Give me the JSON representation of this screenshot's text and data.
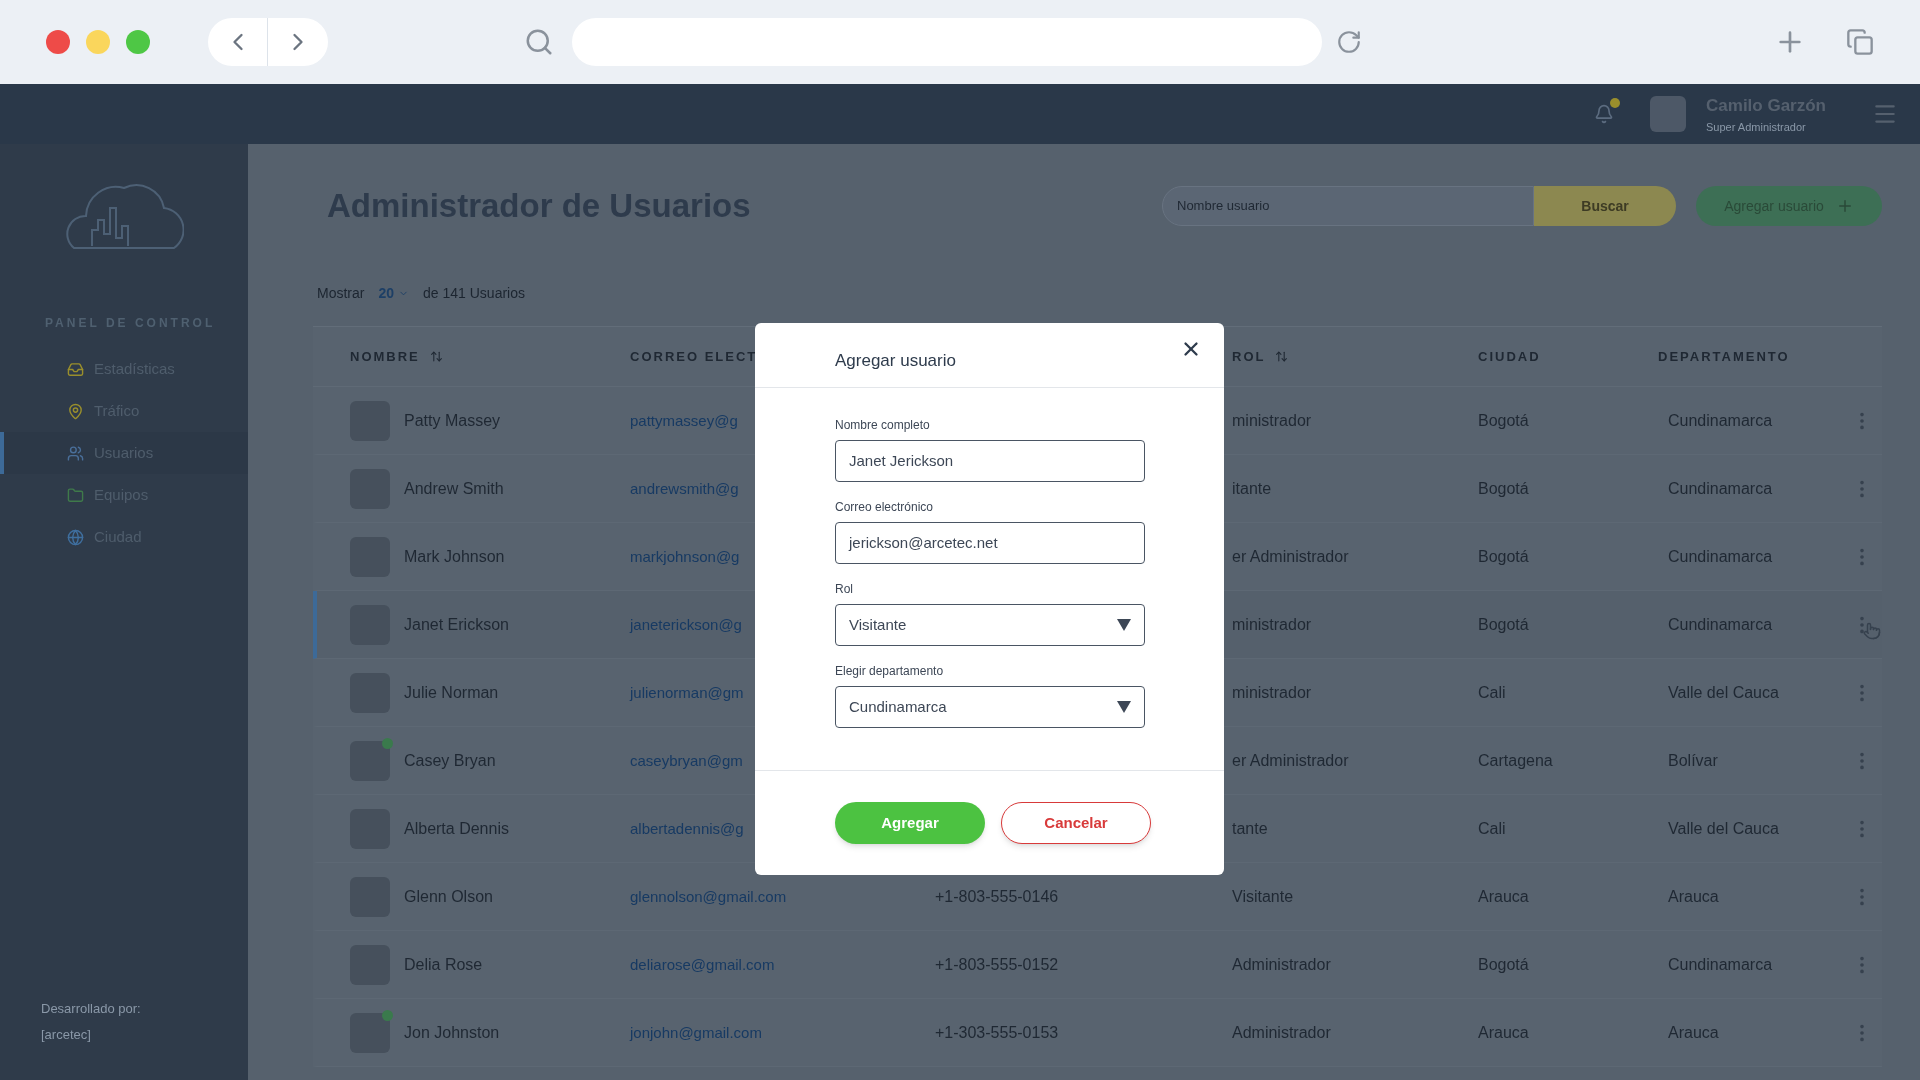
{
  "topbar": {
    "notifications": true,
    "user_name": "Camilo Garzón",
    "user_role": "Super Administrador"
  },
  "sidebar": {
    "section": "PANEL DE CONTROL",
    "items": [
      {
        "label": "Estadísticas",
        "kind": "stats",
        "selected": false
      },
      {
        "label": "Tráfico",
        "kind": "pin",
        "selected": false
      },
      {
        "label": "Usuarios",
        "kind": "users",
        "selected": true
      },
      {
        "label": "Equipos",
        "kind": "folder",
        "selected": false
      },
      {
        "label": "Ciudad",
        "kind": "city",
        "selected": false
      }
    ],
    "footer": [
      "Desarrollado por:",
      "[arcetec]"
    ]
  },
  "page": {
    "title": "Administrador de Usuarios",
    "search": {
      "placeholder": "Nombre usuario"
    },
    "search_button": "Buscar",
    "add_button": "Agregar usuario"
  },
  "listing": {
    "show_label": "Mostrar",
    "page_size": "20",
    "total": "de 141 Usuarios"
  },
  "table": {
    "columns": [
      {
        "label": "NOMBRE",
        "sortable": true
      },
      {
        "label": "CORREO ELECT"
      },
      {
        "label": "ROL",
        "sortable": true
      },
      {
        "label": "CIUDAD",
        "sortable": false
      },
      {
        "label": "DEPARTAMENTO",
        "sortable": false
      }
    ],
    "rows": [
      {
        "name": "Patty Massey",
        "email": "pattymassey@g",
        "role": "ministrador",
        "city": "Bogotá",
        "department": "Cundinamarca",
        "online": false,
        "selected": false
      },
      {
        "name": "Andrew Smith",
        "email": "andrewsmith@g",
        "role": "itante",
        "city": "Bogotá",
        "department": "Cundinamarca",
        "online": false,
        "selected": false
      },
      {
        "name": "Mark Johnson",
        "email": "markjohnson@g",
        "role": "er Administrador",
        "city": "Bogotá",
        "department": "Cundinamarca",
        "online": false,
        "selected": false
      },
      {
        "name": "Janet Erickson",
        "email": "janeterickson@g",
        "role": "ministrador",
        "city": "Bogotá",
        "department": "Cundinamarca",
        "online": false,
        "selected": true
      },
      {
        "name": "Julie Norman",
        "email": "julienorman@gm",
        "role": "ministrador",
        "city": "Cali",
        "department": "Valle del Cauca",
        "online": false,
        "selected": false
      },
      {
        "name": "Casey Bryan",
        "email": "caseybryan@gm",
        "role": "er Administrador",
        "city": "Cartagena",
        "department": "Bolívar",
        "online": true,
        "selected": false
      },
      {
        "name": "Alberta Dennis",
        "email": "albertadennis@g",
        "role": "tante",
        "city": "Cali",
        "department": "Valle del Cauca",
        "online": false,
        "selected": false
      },
      {
        "name": "Glenn Olson",
        "email": "glennolson@gmail.com",
        "phone": "+1-803-555-0146",
        "role": "Visitante",
        "city": "Arauca",
        "department": "Arauca",
        "online": false,
        "selected": false
      },
      {
        "name": "Delia Rose",
        "email": "deliarose@gmail.com",
        "phone": "+1-803-555-0152",
        "role": "Administrador",
        "city": "Bogotá",
        "department": "Cundinamarca",
        "online": false,
        "selected": false
      },
      {
        "name": "Jon Johnston",
        "email": "jonjohn@gmail.com",
        "phone": "+1-303-555-0153",
        "role": "Administrador",
        "city": "Arauca",
        "department": "Arauca",
        "online": true,
        "selected": false
      }
    ]
  },
  "modal": {
    "title": "Agregar usuario",
    "fields": [
      {
        "label": "Nombre completo",
        "value": "Janet Jerickson",
        "kind": "text"
      },
      {
        "label": "Correo electrónico",
        "value": "jerickson@arcetec.net",
        "kind": "text"
      },
      {
        "label": "Rol",
        "value": "Visitante",
        "kind": "select"
      },
      {
        "label": "Elegir departamento",
        "value": "Cundinamarca",
        "kind": "select"
      }
    ],
    "buttons": [
      {
        "label": "Agregar",
        "kind": "primary"
      },
      {
        "label": "Cancelar",
        "kind": "secondary"
      }
    ]
  }
}
